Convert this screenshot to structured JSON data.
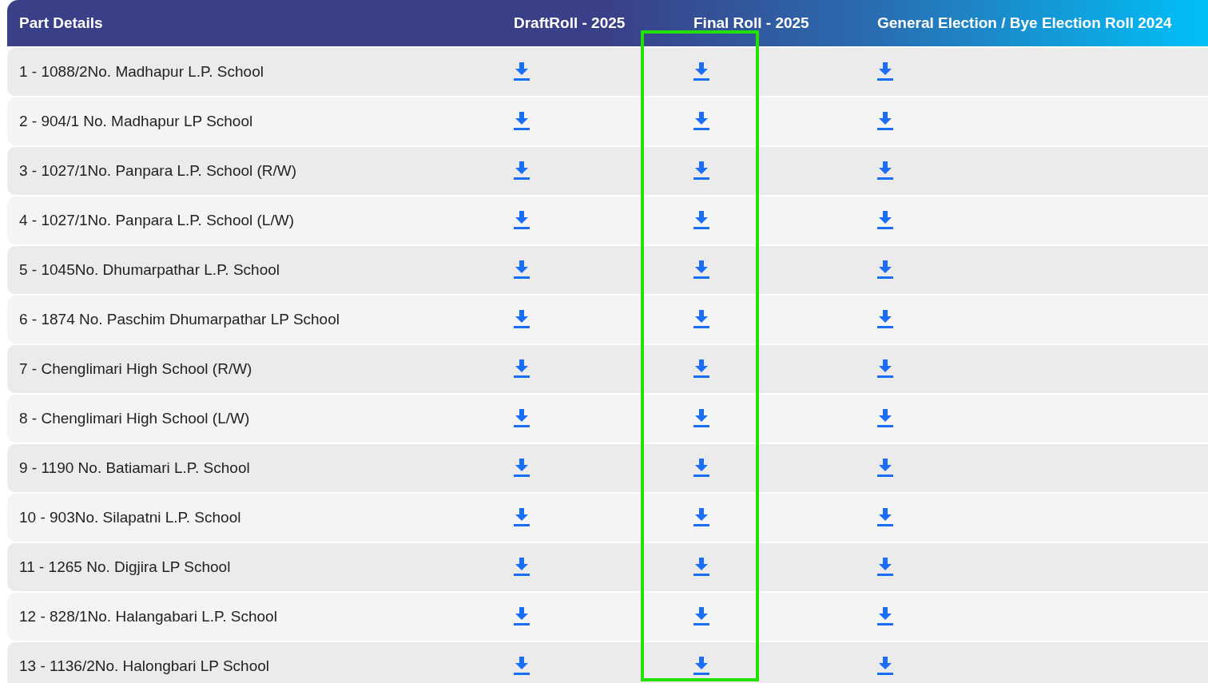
{
  "table": {
    "columns": [
      {
        "label": "Part Details",
        "highlighted": false
      },
      {
        "label": "DraftRoll - 2025",
        "highlighted": false
      },
      {
        "label": "Final Roll - 2025",
        "highlighted": true
      },
      {
        "label": "General Election / Bye Election Roll 2024",
        "highlighted": false
      }
    ],
    "rows": [
      {
        "part": "1 - 1088/2No. Madhapur L.P. School"
      },
      {
        "part": "2 - 904/1 No. Madhapur LP School"
      },
      {
        "part": "3 - 1027/1No. Panpara L.P. School (R/W)"
      },
      {
        "part": "4 - 1027/1No. Panpara L.P. School (L/W)"
      },
      {
        "part": "5 - 1045No. Dhumarpathar L.P. School"
      },
      {
        "part": "6 - 1874 No. Paschim Dhumarpathar LP School"
      },
      {
        "part": "7 - Chenglimari High School (R/W)"
      },
      {
        "part": "8 - Chenglimari High School (L/W)"
      },
      {
        "part": "9 - 1190 No. Batiamari L.P. School"
      },
      {
        "part": "10 - 903No. Silapatni L.P. School"
      },
      {
        "part": "11 - 1265 No. Digjira LP School"
      },
      {
        "part": "12 - 828/1No. Halangabari L.P. School"
      },
      {
        "part": "13 - 1136/2No. Halongbari LP School"
      }
    ]
  }
}
